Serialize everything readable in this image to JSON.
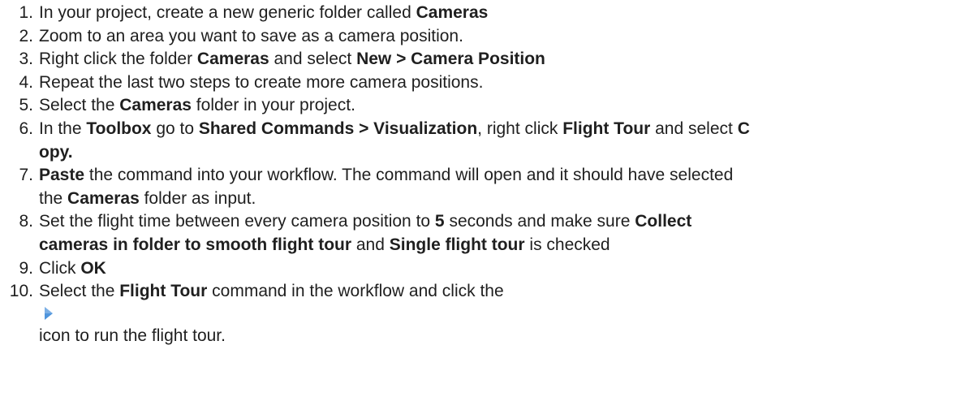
{
  "steps": [
    {
      "number": "1.",
      "parts": [
        {
          "text": "In your project, create a new generic folder called ",
          "bold": false
        },
        {
          "text": "Cameras",
          "bold": true
        }
      ]
    },
    {
      "number": "2.",
      "parts": [
        {
          "text": "Zoom to an area you want to save as a camera position.",
          "bold": false
        }
      ]
    },
    {
      "number": "3.",
      "parts": [
        {
          "text": "Right click the folder ",
          "bold": false
        },
        {
          "text": "Cameras",
          "bold": true
        },
        {
          "text": " and select ",
          "bold": false
        },
        {
          "text": "New > Camera Position",
          "bold": true
        }
      ]
    },
    {
      "number": "4.",
      "parts": [
        {
          "text": "Repeat the last two steps to create more camera positions.",
          "bold": false
        }
      ]
    },
    {
      "number": "5.",
      "parts": [
        {
          "text": "Select the ",
          "bold": false
        },
        {
          "text": "Cameras",
          "bold": true
        },
        {
          "text": " folder in your project.",
          "bold": false
        }
      ]
    },
    {
      "number": "6.",
      "parts": [
        {
          "text": "In the ",
          "bold": false
        },
        {
          "text": "Toolbox",
          "bold": true
        },
        {
          "text": " go to ",
          "bold": false
        },
        {
          "text": "Shared Commands > Visualization",
          "bold": true
        },
        {
          "text": ", right click ",
          "bold": false
        },
        {
          "text": "Flight Tour",
          "bold": true
        },
        {
          "text": " and select ",
          "bold": false
        },
        {
          "text": "C",
          "bold": true
        },
        {
          "break": true
        },
        {
          "text": "opy.",
          "bold": true
        }
      ]
    },
    {
      "number": "7.",
      "parts": [
        {
          "text": "Paste",
          "bold": true
        },
        {
          "text": " the command into your workflow. The command will open and it should have selected",
          "bold": false
        },
        {
          "break": true
        },
        {
          "text": "the ",
          "bold": false
        },
        {
          "text": "Cameras",
          "bold": true
        },
        {
          "text": " folder as input.",
          "bold": false
        }
      ]
    },
    {
      "number": "8.",
      "parts": [
        {
          "text": "Set the flight time between every camera position to ",
          "bold": false
        },
        {
          "text": "5",
          "bold": true
        },
        {
          "text": " seconds and make sure ",
          "bold": false
        },
        {
          "text": "Collect",
          "bold": true
        },
        {
          "break": true
        },
        {
          "text": "cameras in folder to smooth flight tour",
          "bold": true
        },
        {
          "text": " and ",
          "bold": false
        },
        {
          "text": "Single flight tour",
          "bold": true
        },
        {
          "text": " is checked",
          "bold": false
        }
      ]
    },
    {
      "number": "9.",
      "parts": [
        {
          "text": "Click ",
          "bold": false
        },
        {
          "text": "OK",
          "bold": true
        }
      ]
    },
    {
      "number": "10.",
      "parts": [
        {
          "text": "Select the ",
          "bold": false
        },
        {
          "text": "Flight Tour",
          "bold": true
        },
        {
          "text": " command in the workflow and click the",
          "bold": false
        },
        {
          "icon": "run-icon",
          "color": "#4f95dc"
        },
        {
          "text": "icon to run the flight tour.",
          "bold": false
        }
      ]
    }
  ]
}
